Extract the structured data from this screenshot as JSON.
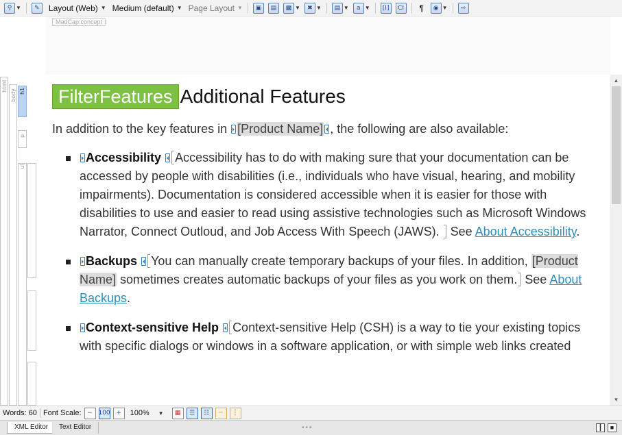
{
  "toolbar": {
    "layout_mode": "Layout (Web)",
    "medium": "Medium (default)",
    "page_layout": "Page Layout",
    "pilcrow": "¶"
  },
  "editor": {
    "xml_tag_label": "MadCap:concept",
    "structure_labels": {
      "html": "html",
      "body": "body",
      "h1": "h1",
      "p": "p",
      "ul": "ul"
    }
  },
  "document": {
    "heading_filter": "FilterFeatures",
    "heading_text": "Additional Features",
    "intro_before": "In addition to the key features in ",
    "product_name": "[Product Name]",
    "intro_after": ", the following are also available:",
    "features": [
      {
        "term": "Accessibility",
        "text": "Accessibility has to do with making sure that your documentation can be accessed by people with disabilities (i.e., individuals who have visual, hearing, and mobility impairments). Documentation is considered accessible when it is easier for those with disabilities to use and easier to read using assistive technologies such as Microsoft Windows Narrator, Connect Outloud, and Job Access With Speech (JAWS).",
        "see": " See ",
        "link": "About Accessibility",
        "after": "."
      },
      {
        "term": "Backups",
        "text_before": "You can manually create temporary backups of your files. In addition, ",
        "product_name": "[Product Name]",
        "text_after": " sometimes creates automatic backups of your files as you work on them.",
        "see": " See ",
        "link": "About Backups",
        "after": "."
      },
      {
        "term": "Context-sensitive Help",
        "text": "Context-sensitive Help (CSH) is a way to tie your existing topics with specific dialogs or windows in a software application, or with simple web links created"
      }
    ]
  },
  "statusbar": {
    "words": "Words: 60",
    "font_scale_label": "Font Scale:",
    "zoom": "100%"
  },
  "tabs": {
    "xml_editor": "XML Editor",
    "text_editor": "Text Editor"
  },
  "colors": {
    "filter_badge": "#7dc142",
    "link": "#2b8fb8",
    "marker": "#2e7fc8",
    "h1_structure_bar": "#bcd4f4"
  }
}
